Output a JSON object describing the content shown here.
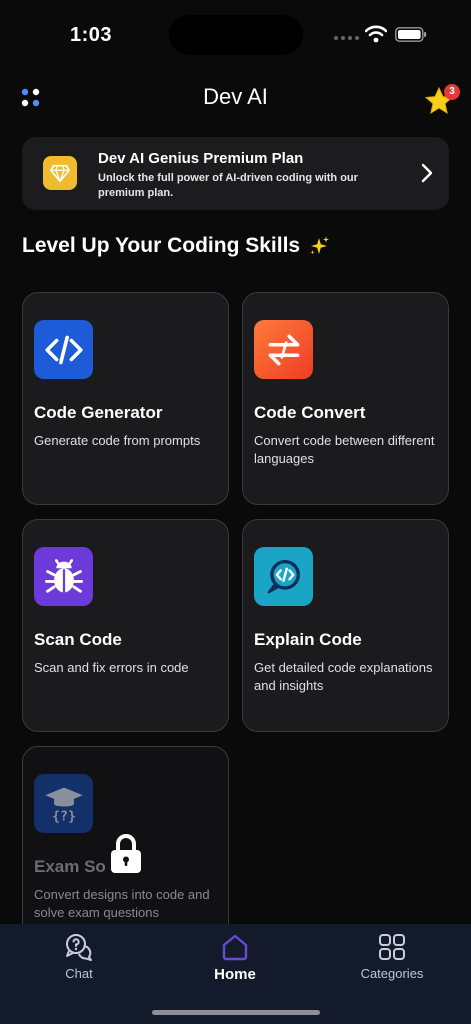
{
  "status_bar": {
    "time": "1:03"
  },
  "header": {
    "title": "Dev AI",
    "badge_count": "3"
  },
  "premium": {
    "title": "Dev AI Genius Premium Plan",
    "subtitle": "Unlock the full power of AI-driven coding with our premium plan."
  },
  "section": {
    "title": "Level Up Your Coding Skills"
  },
  "cards": [
    {
      "title": "Code Generator",
      "description": "Generate code from prompts",
      "icon": "code-brackets-icon",
      "color": "#1e5bd8",
      "locked": false
    },
    {
      "title": "Code Convert",
      "description": "Convert code between different languages",
      "icon": "convert-arrows-icon",
      "color": "#f2562c",
      "locked": false
    },
    {
      "title": "Scan Code",
      "description": "Scan and fix errors in code",
      "icon": "bug-icon",
      "color": "#6c3ad8",
      "locked": false
    },
    {
      "title": "Explain Code",
      "description": "Get detailed code explanations and insights",
      "icon": "chat-code-icon",
      "color": "#1aa5c7",
      "locked": false
    },
    {
      "title": "Exam So",
      "description": "Convert designs into code and solve exam questions",
      "icon": "graduation-cap-icon",
      "color": "#13306a",
      "locked": true
    }
  ],
  "tabs": [
    {
      "label": "Chat",
      "icon": "chat-question-icon"
    },
    {
      "label": "Home",
      "icon": "home-icon",
      "active": true
    },
    {
      "label": "Categories",
      "icon": "grid-icon"
    }
  ],
  "colors": {
    "background": "#0a0a0a",
    "card": "#1b1b1d",
    "tabbar": "#121a2b",
    "accent_premium": "#f0bc2e",
    "home_tab": "#6a4bd0"
  }
}
